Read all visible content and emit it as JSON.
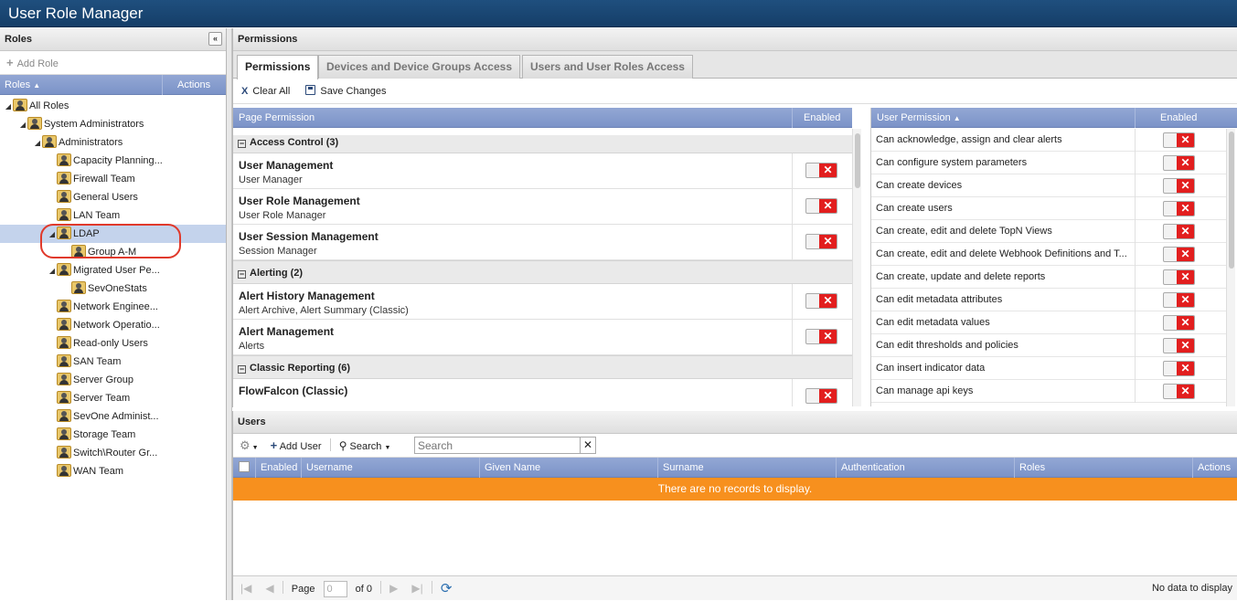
{
  "app": {
    "title": "User Role Manager"
  },
  "roles": {
    "header": "Roles",
    "collapse_icon": "«",
    "add_role": "Add Role",
    "col_roles": "Roles",
    "col_actions": "Actions",
    "tree": [
      {
        "label": "All Roles",
        "expanded": true
      },
      {
        "label": "System Administrators",
        "expanded": true
      },
      {
        "label": "Administrators",
        "expanded": true
      },
      {
        "label": "Capacity Planning..."
      },
      {
        "label": "Firewall Team"
      },
      {
        "label": "General Users"
      },
      {
        "label": "LAN Team"
      },
      {
        "label": "LDAP",
        "expanded": true,
        "selected": true
      },
      {
        "label": "Group A-M"
      },
      {
        "label": "Migrated User Pe...",
        "expanded": true
      },
      {
        "label": "SevOneStats"
      },
      {
        "label": "Network Enginee..."
      },
      {
        "label": "Network Operatio..."
      },
      {
        "label": "Read-only Users"
      },
      {
        "label": "SAN Team"
      },
      {
        "label": "Server Group"
      },
      {
        "label": "Server Team"
      },
      {
        "label": "SevOne Administ..."
      },
      {
        "label": "Storage Team"
      },
      {
        "label": "Switch\\Router Gr..."
      },
      {
        "label": "WAN Team"
      }
    ]
  },
  "permissions": {
    "header": "Permissions",
    "tabs": [
      "Permissions",
      "Devices and Device Groups Access",
      "Users and User Roles Access"
    ],
    "clear_all": "Clear All",
    "save_changes": "Save Changes",
    "page_permission_col": "Page Permission",
    "enabled_col": "Enabled",
    "groups": [
      {
        "title": "Access Control (3)",
        "rows": [
          {
            "name": "User Management",
            "sub": "User Manager"
          },
          {
            "name": "User Role Management",
            "sub": "User Role Manager"
          },
          {
            "name": "User Session Management",
            "sub": "Session Manager"
          }
        ]
      },
      {
        "title": "Alerting (2)",
        "rows": [
          {
            "name": "Alert History Management",
            "sub": "Alert Archive, Alert Summary (Classic)"
          },
          {
            "name": "Alert Management",
            "sub": "Alerts"
          }
        ]
      },
      {
        "title": "Classic Reporting (6)",
        "rows": [
          {
            "name": "FlowFalcon (Classic)",
            "sub": ""
          }
        ]
      }
    ],
    "user_permission_col": "User Permission",
    "user_enabled_col": "Enabled",
    "user_permissions": [
      "Can acknowledge, assign and clear alerts",
      "Can configure system parameters",
      "Can create devices",
      "Can create users",
      "Can create, edit and delete TopN Views",
      "Can create, edit and delete Webhook Definitions and T...",
      "Can create, update and delete reports",
      "Can edit metadata attributes",
      "Can edit metadata values",
      "Can edit thresholds and policies",
      "Can insert indicator data",
      "Can manage api keys"
    ],
    "toggle_off": "✕"
  },
  "users": {
    "header": "Users",
    "add_user": "Add User",
    "search_label": "Search",
    "search_placeholder": "Search",
    "columns": [
      "Enabled",
      "Username",
      "Given Name",
      "Surname",
      "Authentication",
      "Roles",
      "Actions"
    ],
    "no_records": "There are no records to display.",
    "pager": {
      "page_label": "Page",
      "page_value": "0",
      "of_label": "of 0",
      "status": "No data to display"
    }
  }
}
